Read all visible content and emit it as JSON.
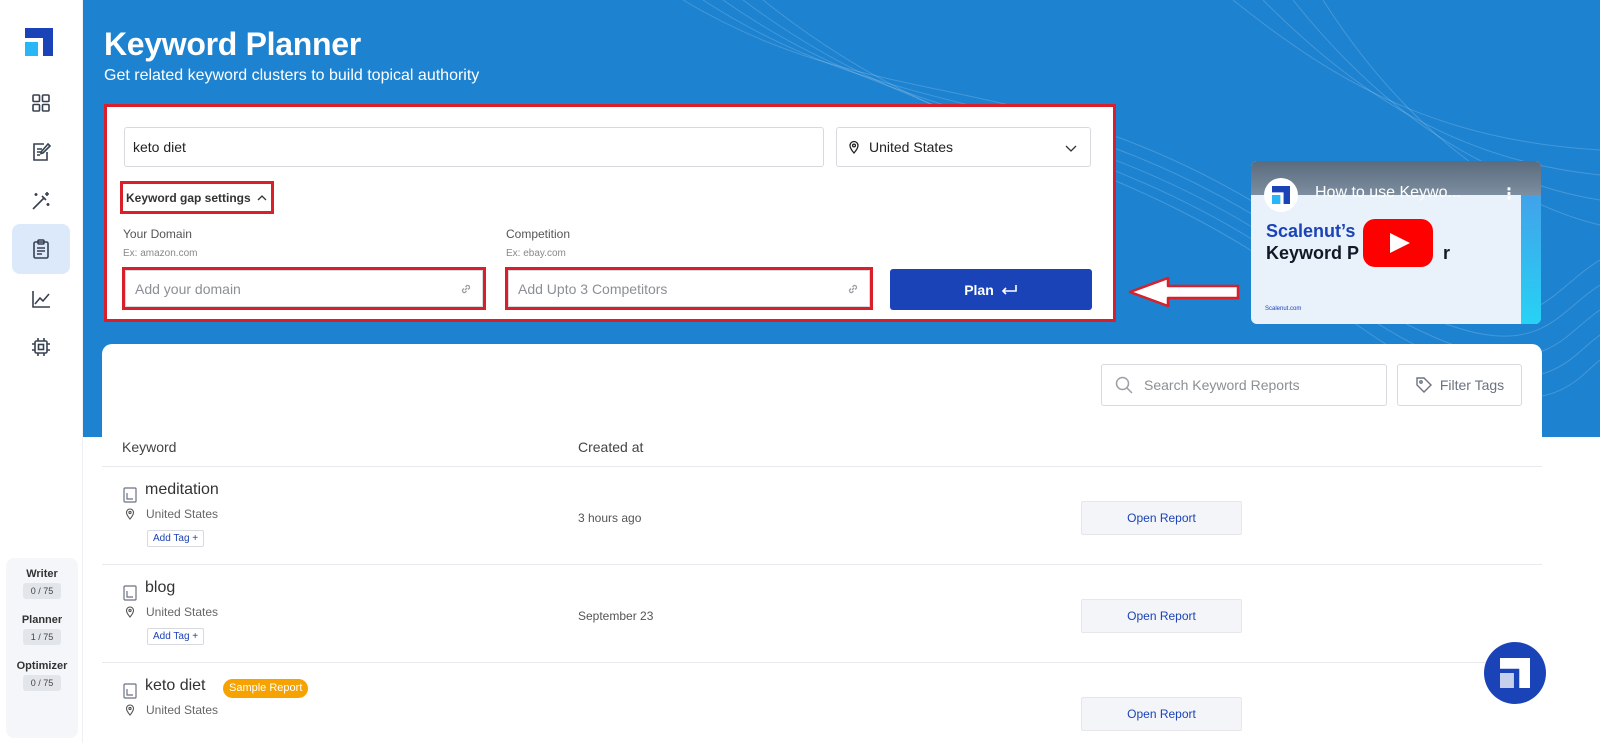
{
  "app": {
    "title": "Keyword Planner",
    "subtitle": "Get related keyword clusters to build topical authority"
  },
  "sidebar": {
    "items": [
      {
        "icon": "grid-icon"
      },
      {
        "icon": "document-edit-icon"
      },
      {
        "icon": "magic-wand-icon"
      },
      {
        "icon": "clipboard-icon",
        "active": true
      },
      {
        "icon": "line-chart-icon"
      },
      {
        "icon": "chip-icon"
      }
    ],
    "usage": [
      {
        "label": "Writer",
        "count": "0 / 75"
      },
      {
        "label": "Planner",
        "count": "1 / 75"
      },
      {
        "label": "Optimizer",
        "count": "0 / 75"
      }
    ]
  },
  "form": {
    "keyword_value": "keto diet",
    "country": "United States",
    "gap_settings_label": "Keyword gap settings",
    "your_domain_label": "Your Domain",
    "your_domain_hint": "Ex: amazon.com",
    "your_domain_placeholder": "Add your domain",
    "competition_label": "Competition",
    "competition_hint": "Ex: ebay.com",
    "competition_placeholder": "Add Upto 3 Competitors",
    "plan_label": "Plan"
  },
  "video": {
    "title": "How to use Keywo...",
    "brand": "Scalenut’s",
    "name": "Keyword P",
    "name_tail": "r",
    "url": "Scalenut.com"
  },
  "reports": {
    "search_placeholder": "Search Keyword Reports",
    "filter_label": "Filter Tags",
    "columns": {
      "keyword": "Keyword",
      "created": "Created at"
    },
    "rows": [
      {
        "keyword": "meditation",
        "location": "United States",
        "tag": "Add Tag +",
        "created": "3 hours ago",
        "action": "Open Report"
      },
      {
        "keyword": "blog",
        "location": "United States",
        "tag": "Add Tag +",
        "created": "September 23",
        "action": "Open Report"
      },
      {
        "keyword": "keto diet",
        "badge": "Sample Report",
        "location": "United States",
        "action": "Open Report"
      }
    ]
  },
  "colors": {
    "brand_blue": "#1b43b8",
    "hero_blue": "#1d82d0",
    "highlight_red": "#d81f2a",
    "badge_orange": "#f6a200"
  }
}
